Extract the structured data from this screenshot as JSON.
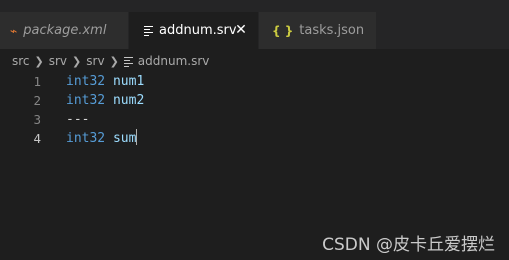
{
  "tabs": [
    {
      "label": "package.xml",
      "icon": "rss-icon"
    },
    {
      "label": "addnum.srv",
      "icon": "lines-icon",
      "active": true
    },
    {
      "label": "tasks.json",
      "icon": "json-braces-icon"
    }
  ],
  "breadcrumb": [
    "src",
    "srv",
    "srv",
    "addnum.srv"
  ],
  "editor": {
    "lines": [
      {
        "number": "1",
        "type": "int32",
        "name": "num1"
      },
      {
        "number": "2",
        "type": "int32",
        "name": "num2"
      },
      {
        "number": "3",
        "text": "---"
      },
      {
        "number": "4",
        "type": "int32",
        "name": "sum"
      }
    ]
  },
  "watermark": "CSDN @皮卡丘爱摆烂",
  "colors": {
    "background": "#1e1e1e",
    "tab_bar": "#252526",
    "keyword": "#569cd6",
    "identifier": "#9cdcfe"
  }
}
